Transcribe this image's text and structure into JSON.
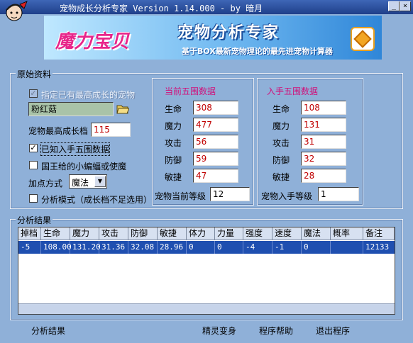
{
  "window": {
    "title": "宠物成长分析专家 Version 1.14.000 - by 暗月",
    "minimize_label": "_",
    "close_label": "×"
  },
  "banner": {
    "logo_text": "魔力宝贝",
    "title": "宠物分析专家",
    "subtitle": "基于BOX最新宠物理论的最先进宠物计算器"
  },
  "original": {
    "group_title": "原始资料",
    "max_growth_checkbox": {
      "label": "指定已有最高成长的宠物",
      "checked": true,
      "enabled": false
    },
    "pet_name_value": "粉红菇",
    "max_growth_label": "宠物最高成长档",
    "max_growth_value": "115",
    "known_stats_checkbox": {
      "label": "已知入手五围数据",
      "checked": true,
      "mark": "✓"
    },
    "king_bat_checkbox": {
      "label": "国王给的小蝙蝠或使魔",
      "checked": false
    },
    "point_mode_label": "加点方式",
    "point_mode_value": "魔法",
    "analysis_mode_checkbox": {
      "label": "分析模式（成长档不足选用）",
      "checked": false
    }
  },
  "current": {
    "title": "当前五围数据",
    "stats": [
      {
        "label": "生命",
        "value": "308"
      },
      {
        "label": "魔力",
        "value": "477"
      },
      {
        "label": "攻击",
        "value": "56"
      },
      {
        "label": "防御",
        "value": "59"
      },
      {
        "label": "敏捷",
        "value": "47"
      }
    ],
    "level_label": "宠物当前等级",
    "level_value": "12"
  },
  "initial": {
    "title": "入手五围数据",
    "stats": [
      {
        "label": "生命",
        "value": "108"
      },
      {
        "label": "魔力",
        "value": "131"
      },
      {
        "label": "攻击",
        "value": "31"
      },
      {
        "label": "防御",
        "value": "32"
      },
      {
        "label": "敏捷",
        "value": "28"
      }
    ],
    "level_label": "宠物入手等级",
    "level_value": "1"
  },
  "results": {
    "group_title": "分析结果",
    "columns": [
      "掉档",
      "生命",
      "魔力",
      "攻击",
      "防御",
      "敏捷",
      "体力",
      "力量",
      "强度",
      "速度",
      "魔法",
      "概率",
      "备注"
    ],
    "rows": [
      [
        "-5",
        "108.00",
        "131.20",
        "31.36",
        "32.08",
        "28.96",
        "0",
        "0",
        "-4",
        "-1",
        "0",
        "",
        "12133"
      ]
    ]
  },
  "footer": {
    "result_label": "分析结果",
    "transform_button": "精灵变身",
    "help_button": "程序帮助",
    "exit_button": "退出程序"
  }
}
